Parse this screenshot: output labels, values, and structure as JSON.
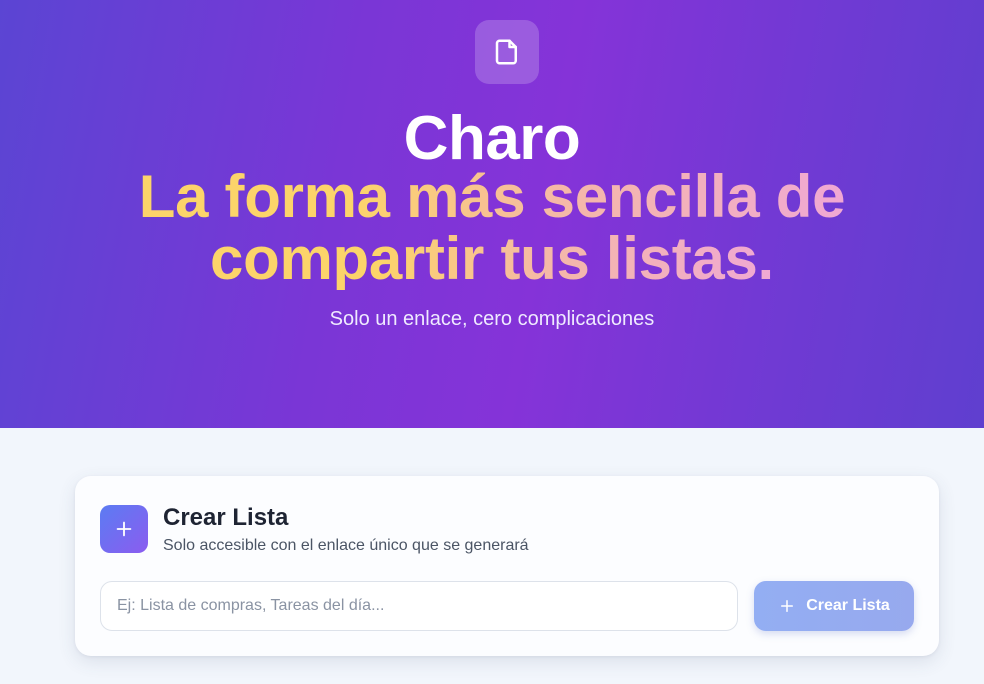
{
  "hero": {
    "logo_icon": "document-icon",
    "title": "Charo",
    "tagline_line1": "La forma más sencilla de",
    "tagline_line2": "compartir tus listas.",
    "subtitle": "Solo un enlace, cero complicaciones"
  },
  "create_card": {
    "icon": "plus-icon",
    "title": "Crear Lista",
    "description": "Solo accesible con el enlace único que se generará",
    "input": {
      "value": "",
      "placeholder": "Ej: Lista de compras, Tareas del día..."
    },
    "button": {
      "icon": "plus-icon",
      "label": "Crear Lista"
    }
  },
  "colors": {
    "hero_gradient_start": "#5b45d3",
    "hero_gradient_mid": "#8533d8",
    "tagline_gradient_start": "#fcd46a",
    "tagline_gradient_end": "#f0a8d4",
    "button_bg": "#93aef3",
    "page_bg": "#f2f6fc"
  }
}
